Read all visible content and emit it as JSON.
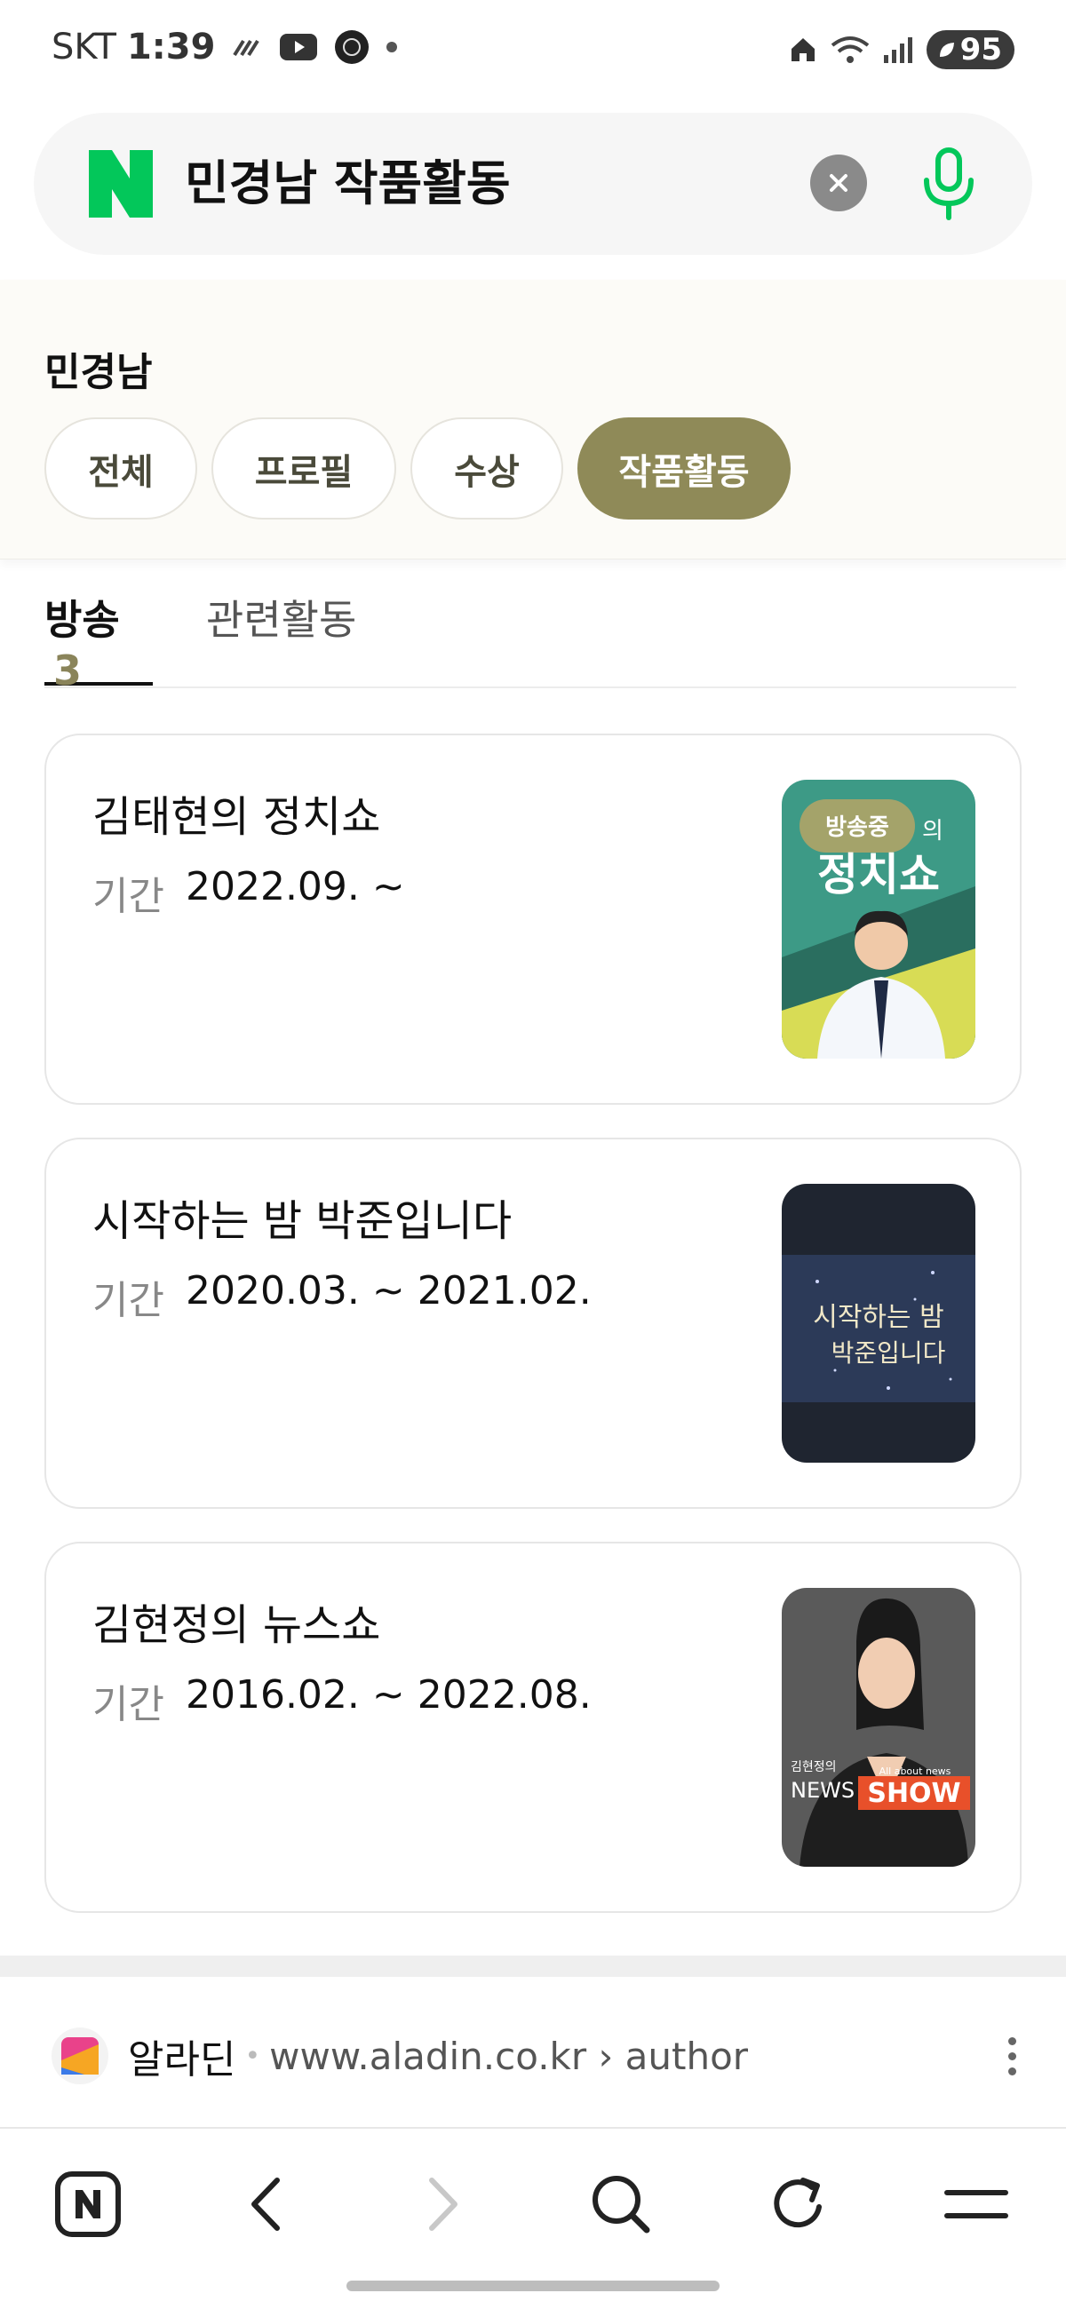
{
  "status_bar": {
    "carrier": "SKT",
    "time": "1:39",
    "battery": "95"
  },
  "search": {
    "query": "민경남 작품활동",
    "icons": [
      "naver-n-logo",
      "clear-icon",
      "mic-icon"
    ],
    "accent_color": "#03c75a"
  },
  "entity": {
    "name": "민경남",
    "tabs": [
      {
        "label": "전체",
        "active": false
      },
      {
        "label": "프로필",
        "active": false
      },
      {
        "label": "수상",
        "active": false
      },
      {
        "label": "작품활동",
        "active": true
      }
    ],
    "active_color": "#8f8a58"
  },
  "subtabs": {
    "broadcast": {
      "label": "방송",
      "count": "3"
    },
    "related": {
      "label": "관련활동"
    }
  },
  "works": [
    {
      "title": "김태현의 정치쇼",
      "period_label": "기간",
      "period": "2022.09. ~",
      "badge": "방송중",
      "thumb_title": "정치쇼",
      "thumb_suffix": "의"
    },
    {
      "title": "시작하는 밤 박준입니다",
      "period_label": "기간",
      "period": "2020.03. ~ 2021.02.",
      "thumb_line1": "시작하는 밤",
      "thumb_line2": "박준입니다"
    },
    {
      "title": "김현정의 뉴스쇼",
      "period_label": "기간",
      "period": "2016.02. ~ 2022.08.",
      "thumb_small": "김현정의",
      "thumb_news": "NEWS",
      "thumb_show": "SHOW",
      "thumb_tag": "All about news"
    }
  ],
  "source": {
    "name": "알라딘",
    "url": "www.aladin.co.kr › author"
  },
  "bottom_nav": [
    "naver-home-icon",
    "back-icon",
    "forward-icon",
    "search-icon",
    "refresh-icon",
    "menu-icon"
  ]
}
